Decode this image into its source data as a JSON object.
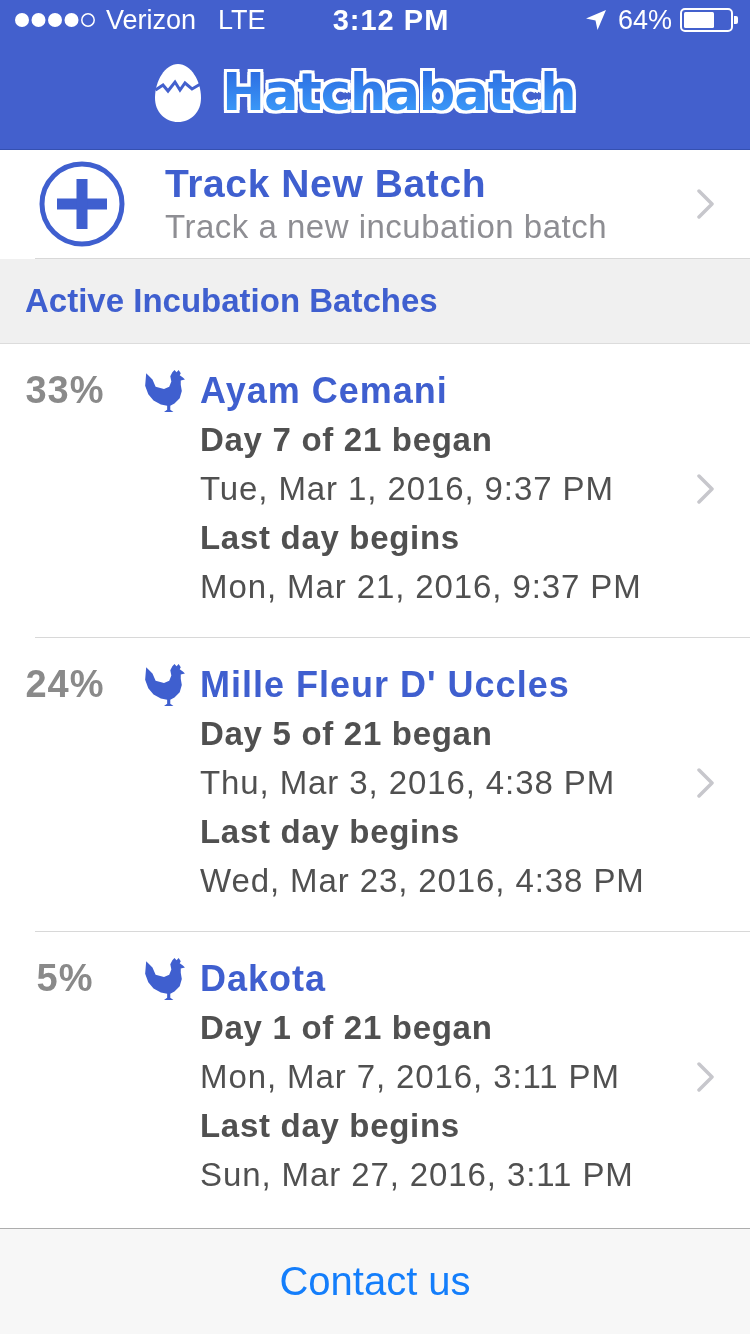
{
  "status_bar": {
    "carrier": "Verizon",
    "network": "LTE",
    "time": "3:12 PM",
    "battery": "64%"
  },
  "nav_bar": {
    "title": "Hatchabatch"
  },
  "track_new": {
    "title": "Track New Batch",
    "subtitle": "Track a new incubation batch"
  },
  "section": {
    "title": "Active Incubation Batches"
  },
  "batches": [
    {
      "percent": "33%",
      "name": "Ayam Cemani",
      "day_label": "Day 7 of 21 began",
      "day_date": "Tue, Mar 1, 2016, 9:37 PM",
      "last_label": "Last day begins",
      "last_date": "Mon, Mar 21, 2016, 9:37 PM"
    },
    {
      "percent": "24%",
      "name": "Mille Fleur D' Uccles",
      "day_label": "Day 5 of 21 began",
      "day_date": "Thu, Mar 3, 2016, 4:38 PM",
      "last_label": "Last day begins",
      "last_date": "Wed, Mar 23, 2016, 4:38 PM"
    },
    {
      "percent": "5%",
      "name": "Dakota",
      "day_label": "Day 1 of 21 began",
      "day_date": "Mon, Mar 7, 2016, 3:11 PM",
      "last_label": "Last day begins",
      "last_date": "Sun, Mar 27, 2016, 3:11 PM"
    }
  ],
  "footer": {
    "link": "Contact us"
  }
}
